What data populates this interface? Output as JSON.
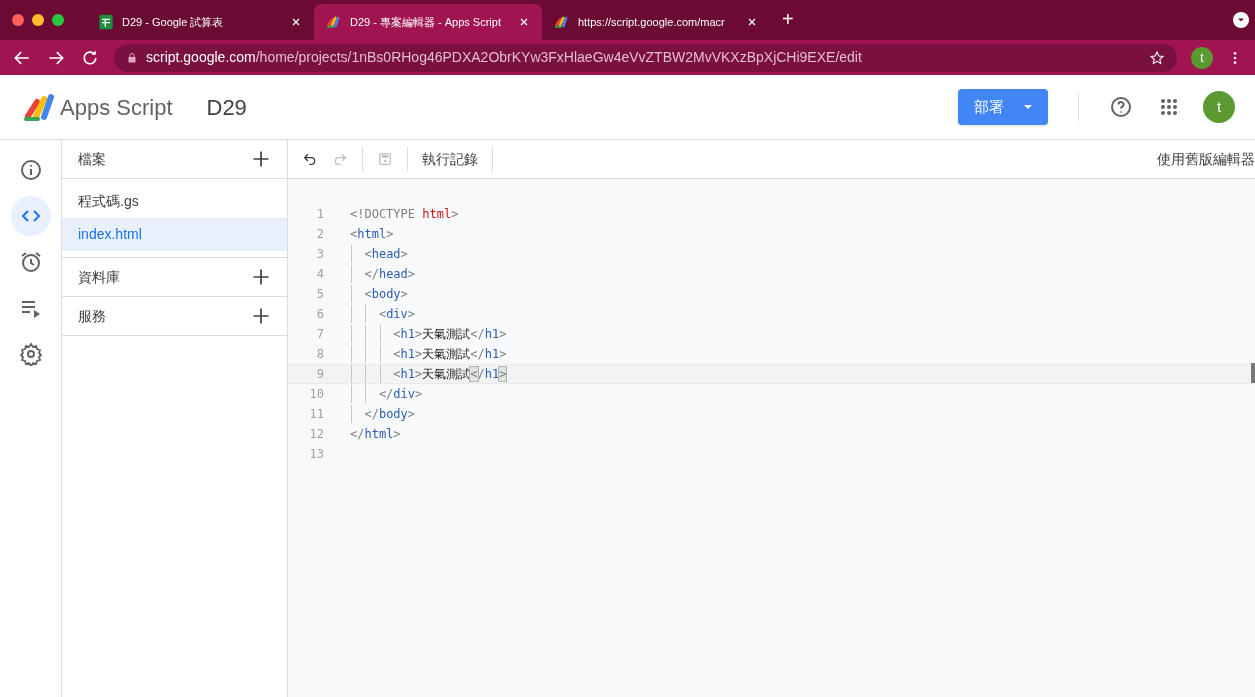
{
  "browser": {
    "tabs": [
      {
        "title": "D29 - Google 試算表",
        "kind": "sheets",
        "selected": false
      },
      {
        "title": "D29 - 專案編輯器 - Apps Script",
        "kind": "script",
        "selected": true
      },
      {
        "title": "https://script.google.com/macr",
        "kind": "script",
        "selected": false
      }
    ],
    "new_tab": "+",
    "address": {
      "host": "script.google.com",
      "path": "/home/projects/1nBs0RHog46PDXA2ObrKYw3FxHlaeGw4eVvZTBW2MvVKXzBpXjCHi9EXE/edit"
    },
    "profile_initial": "t"
  },
  "app": {
    "product": "Apps Script",
    "project": "D29",
    "deploy_button": "部署",
    "avatar_initial": "t"
  },
  "rail": [
    {
      "kind": "info",
      "selected": false
    },
    {
      "kind": "code",
      "selected": true
    },
    {
      "kind": "clock",
      "selected": false
    },
    {
      "kind": "executions",
      "selected": false
    },
    {
      "kind": "settings",
      "selected": false
    }
  ],
  "files_panel": {
    "sections": [
      {
        "title": "檔案",
        "files": [
          {
            "name": "程式碼.gs",
            "selected": false
          },
          {
            "name": "index.html",
            "selected": true
          }
        ]
      },
      {
        "title": "資料庫"
      },
      {
        "title": "服務"
      }
    ]
  },
  "toolbar": {
    "undo_disabled": false,
    "redo_disabled": true,
    "save_disabled": true,
    "log_button": "執行記錄",
    "legacy_link": "使用舊版編輯器"
  },
  "editor": {
    "lines": [
      {
        "number": "1",
        "active": false,
        "tokens": [
          {
            "kind": "punct",
            "text": "<!DOCTYPE "
          },
          {
            "kind": "keyword",
            "text": "html"
          },
          {
            "kind": "punct",
            "text": ">"
          }
        ]
      },
      {
        "number": "2",
        "active": false,
        "tokens": [
          {
            "kind": "punct",
            "text": "<"
          },
          {
            "kind": "tag",
            "text": "html"
          },
          {
            "kind": "punct",
            "text": ">"
          }
        ]
      },
      {
        "number": "3",
        "active": false,
        "tokens": [
          {
            "kind": "punct",
            "text": "  <"
          },
          {
            "kind": "tag",
            "text": "head"
          },
          {
            "kind": "punct",
            "text": ">"
          }
        ]
      },
      {
        "number": "4",
        "active": false,
        "tokens": [
          {
            "kind": "punct",
            "text": "  </"
          },
          {
            "kind": "tag",
            "text": "head"
          },
          {
            "kind": "punct",
            "text": ">"
          }
        ]
      },
      {
        "number": "5",
        "active": false,
        "tokens": [
          {
            "kind": "punct",
            "text": "  <"
          },
          {
            "kind": "tag",
            "text": "body"
          },
          {
            "kind": "punct",
            "text": ">"
          }
        ]
      },
      {
        "number": "6",
        "active": false,
        "tokens": [
          {
            "kind": "punct",
            "text": "    <"
          },
          {
            "kind": "tag",
            "text": "div"
          },
          {
            "kind": "punct",
            "text": ">"
          }
        ]
      },
      {
        "number": "7",
        "active": false,
        "tokens": [
          {
            "kind": "punct",
            "text": "      <"
          },
          {
            "kind": "tag",
            "text": "h1"
          },
          {
            "kind": "punct",
            "text": ">"
          },
          {
            "kind": "text",
            "text": "天氣測試"
          },
          {
            "kind": "punct",
            "text": "</"
          },
          {
            "kind": "tag",
            "text": "h1"
          },
          {
            "kind": "punct",
            "text": ">"
          }
        ]
      },
      {
        "number": "8",
        "active": false,
        "tokens": [
          {
            "kind": "punct",
            "text": "      <"
          },
          {
            "kind": "tag",
            "text": "h1"
          },
          {
            "kind": "punct",
            "text": ">"
          },
          {
            "kind": "text",
            "text": "天氣測試"
          },
          {
            "kind": "punct",
            "text": "</"
          },
          {
            "kind": "tag",
            "text": "h1"
          },
          {
            "kind": "punct",
            "text": ">"
          }
        ]
      },
      {
        "number": "9",
        "active": true,
        "tokens": [
          {
            "kind": "punct",
            "text": "      <"
          },
          {
            "kind": "tag",
            "text": "h1"
          },
          {
            "kind": "punct",
            "text": ">"
          },
          {
            "kind": "text",
            "text": "天氣測試"
          },
          {
            "kind": "bracket",
            "text": "<"
          },
          {
            "kind": "punct",
            "text": "/"
          },
          {
            "kind": "tag",
            "text": "h1"
          },
          {
            "kind": "bracket",
            "text": ">"
          }
        ]
      },
      {
        "number": "10",
        "active": false,
        "tokens": [
          {
            "kind": "punct",
            "text": "    </"
          },
          {
            "kind": "tag",
            "text": "div"
          },
          {
            "kind": "punct",
            "text": ">"
          }
        ]
      },
      {
        "number": "11",
        "active": false,
        "tokens": [
          {
            "kind": "punct",
            "text": "  </"
          },
          {
            "kind": "tag",
            "text": "body"
          },
          {
            "kind": "punct",
            "text": ">"
          }
        ]
      },
      {
        "number": "12",
        "active": false,
        "tokens": [
          {
            "kind": "punct",
            "text": "</"
          },
          {
            "kind": "tag",
            "text": "html"
          },
          {
            "kind": "punct",
            "text": ">"
          }
        ]
      },
      {
        "number": "13",
        "active": false
      }
    ]
  }
}
